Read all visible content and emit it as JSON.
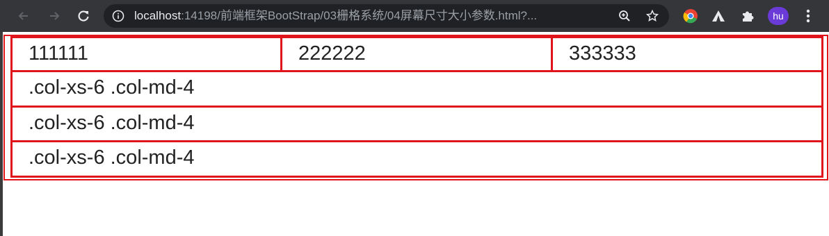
{
  "browser": {
    "url_host": "localhost",
    "url_rest": ":14198/前端框架BootStrap/03栅格系统/04屏幕尺寸大小参数.html?...",
    "avatar_label": "hu"
  },
  "grid": {
    "row1": [
      "111111",
      "222222",
      "333333"
    ],
    "rows": [
      ".col-xs-6 .col-md-4",
      ".col-xs-6 .col-md-4",
      ".col-xs-6 .col-md-4"
    ]
  },
  "colors": {
    "toolbar": "#35363a",
    "omnibox": "#202124",
    "border_red": "#e0151c",
    "avatar": "#6a3bd6"
  },
  "icons": [
    "back-arrow-icon",
    "forward-arrow-icon",
    "reload-icon",
    "site-info-icon",
    "zoom-icon",
    "bookmark-star-icon",
    "chrome-extension-icon",
    "extension-triangle-icon",
    "puzzle-extensions-icon",
    "more-menu-icon"
  ]
}
